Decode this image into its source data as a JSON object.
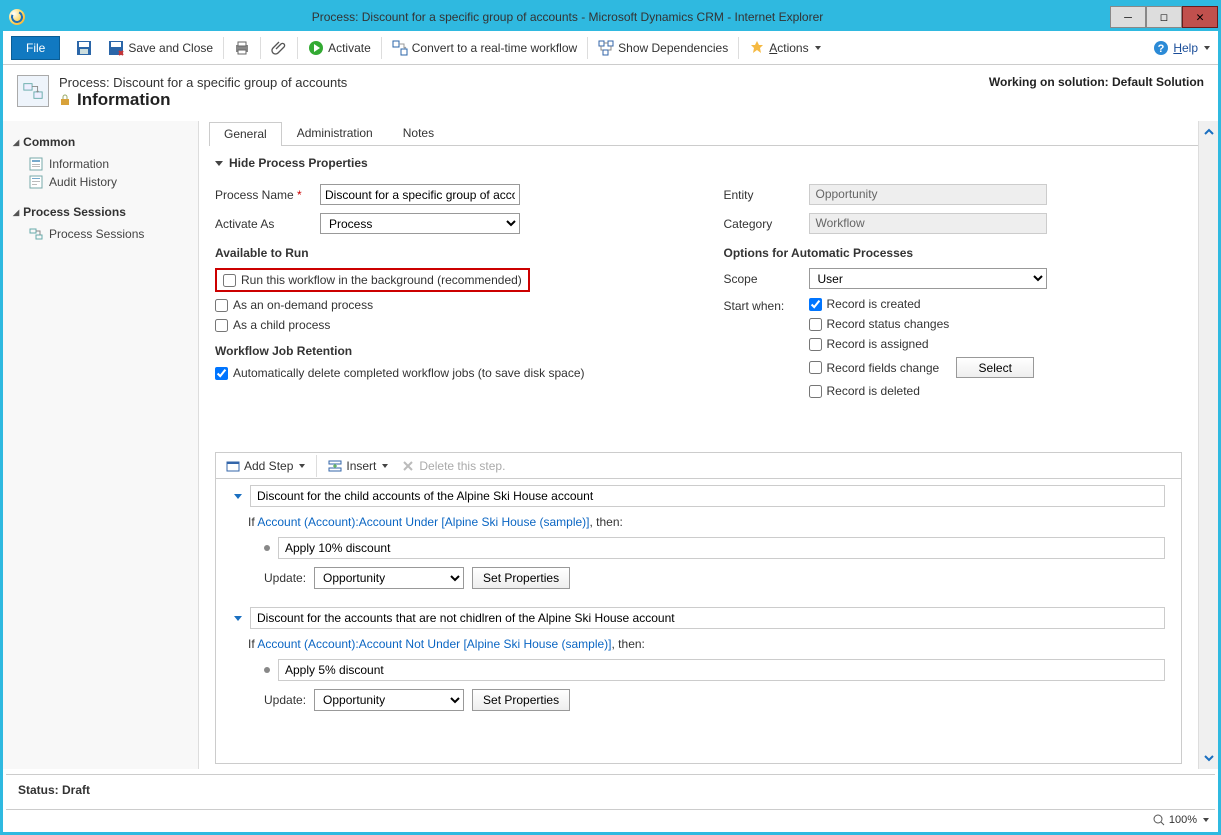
{
  "window": {
    "title": "Process: Discount for a specific group of accounts - Microsoft Dynamics CRM - Internet Explorer"
  },
  "toolbar": {
    "file": "File",
    "save_and_close": "Save and Close",
    "activate": "Activate",
    "convert": "Convert to a real-time workflow",
    "show_deps": "Show Dependencies",
    "actions": "Actions",
    "help": "Help"
  },
  "header": {
    "supertitle": "Process: Discount for a specific group of accounts",
    "title": "Information",
    "solution_label": "Working on solution: Default Solution"
  },
  "nav": {
    "common": "Common",
    "information": "Information",
    "audit": "Audit History",
    "sessions_section": "Process Sessions",
    "sessions": "Process Sessions"
  },
  "tabs": {
    "general": "General",
    "administration": "Administration",
    "notes": "Notes"
  },
  "form": {
    "hide_label": "Hide Process Properties",
    "process_name_label": "Process Name",
    "process_name_value": "Discount for a specific group of accounts",
    "activate_as_label": "Activate As",
    "activate_as_value": "Process",
    "entity_label": "Entity",
    "entity_value": "Opportunity",
    "category_label": "Category",
    "category_value": "Workflow",
    "available_label": "Available to Run",
    "run_bg": "Run this workflow in the background (recommended)",
    "on_demand": "As an on-demand process",
    "child": "As a child process",
    "retention_label": "Workflow Job Retention",
    "auto_delete": "Automatically delete completed workflow jobs (to save disk space)",
    "options_label": "Options for Automatic Processes",
    "scope_label": "Scope",
    "scope_value": "User",
    "start_when_label": "Start when:",
    "rec_created": "Record is created",
    "rec_status": "Record status changes",
    "rec_assigned": "Record is assigned",
    "rec_fields": "Record fields change",
    "select_btn": "Select",
    "rec_deleted": "Record is deleted"
  },
  "steps": {
    "add_step": "Add Step",
    "insert": "Insert",
    "delete": "Delete this step.",
    "block1_title": "Discount for the child accounts of the Alpine Ski House account",
    "block1_if_pre": "If ",
    "block1_if_link": "Account (Account):Account Under [Alpine Ski House (sample)]",
    "block1_if_post": ", then:",
    "block1_action": "Apply 10% discount",
    "update_label": "Update:",
    "update_value": "Opportunity",
    "set_props": "Set Properties",
    "block2_title": "Discount for the accounts that are not chidlren of the Alpine Ski House account",
    "block2_if_pre": "If ",
    "block2_if_link": "Account (Account):Account Not Under [Alpine Ski House (sample)]",
    "block2_if_post": ", then:",
    "block2_action": "Apply 5% discount"
  },
  "status": {
    "text": "Status: Draft",
    "zoom": "100%"
  }
}
